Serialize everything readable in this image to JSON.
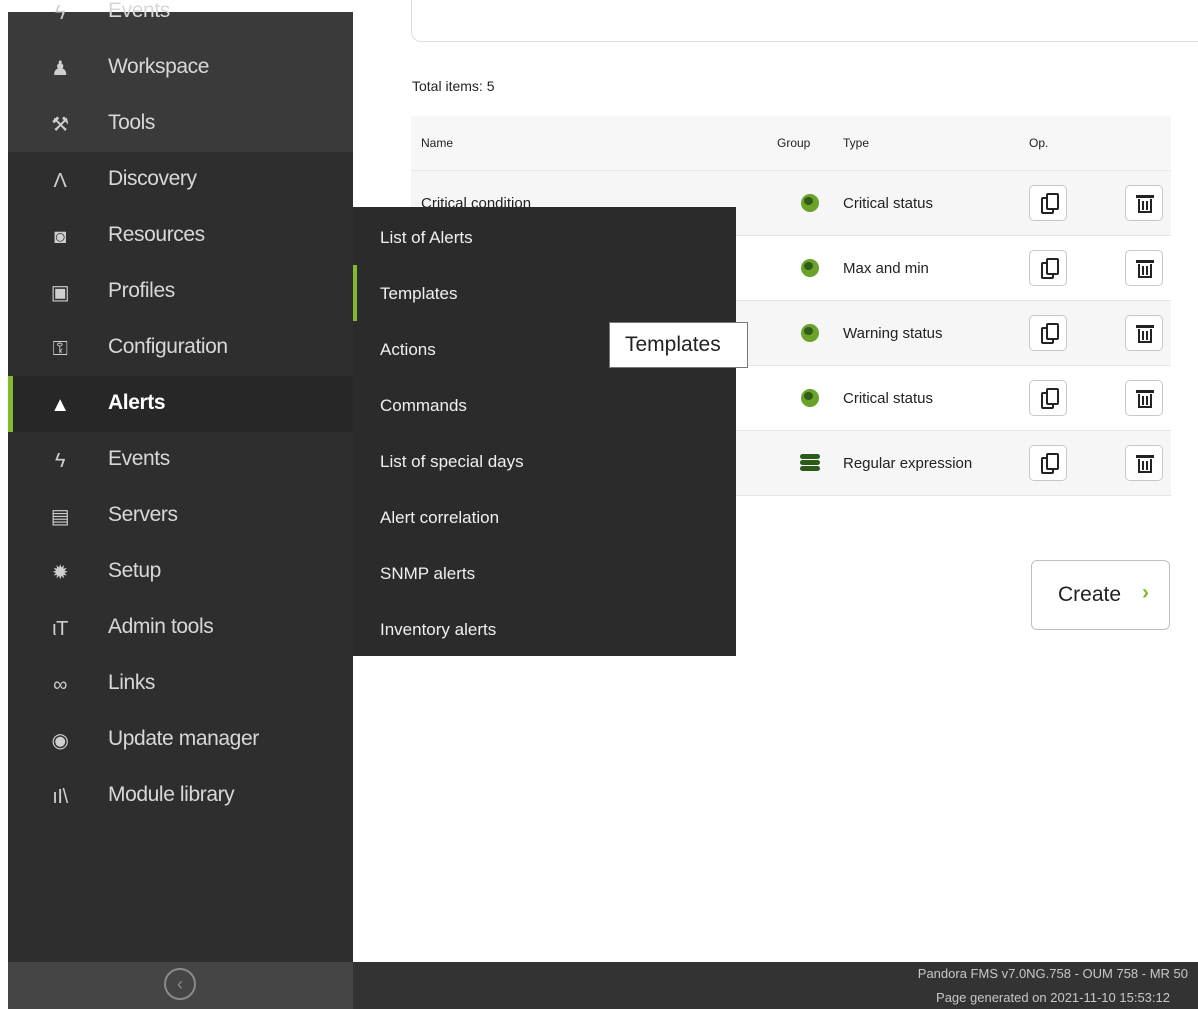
{
  "sidebar": {
    "items": [
      {
        "label": "Events",
        "icon": "lightning-icon",
        "glyph": "ϟ"
      },
      {
        "label": "Workspace",
        "icon": "user-icon",
        "glyph": "♟"
      },
      {
        "label": "Tools",
        "icon": "tools-icon",
        "glyph": "⚒"
      },
      {
        "label": "Discovery",
        "icon": "discovery-icon",
        "glyph": "Λ"
      },
      {
        "label": "Resources",
        "icon": "resources-icon",
        "glyph": "◙"
      },
      {
        "label": "Profiles",
        "icon": "profiles-icon",
        "glyph": "▣"
      },
      {
        "label": "Configuration",
        "icon": "wrench-icon",
        "glyph": "⚿"
      },
      {
        "label": "Alerts",
        "icon": "bell-icon",
        "glyph": "▲"
      },
      {
        "label": "Events",
        "icon": "events-icon",
        "glyph": "ϟ"
      },
      {
        "label": "Servers",
        "icon": "server-icon",
        "glyph": "▤"
      },
      {
        "label": "Setup",
        "icon": "gear-icon",
        "glyph": "✹"
      },
      {
        "label": "Admin tools",
        "icon": "admin-tools-icon",
        "glyph": "ιT"
      },
      {
        "label": "Links",
        "icon": "link-icon",
        "glyph": "∞"
      },
      {
        "label": "Update manager",
        "icon": "update-icon",
        "glyph": "◉"
      },
      {
        "label": "Module library",
        "icon": "library-icon",
        "glyph": "ıI\\"
      }
    ],
    "active_index": 7,
    "collapse_glyph": "‹"
  },
  "main": {
    "total_items": "Total items: 5",
    "table": {
      "headers": [
        "Name",
        "Group",
        "Type",
        "Op."
      ],
      "rows": [
        {
          "name": "Critical condition",
          "group_icon": "globe-icon",
          "type": "Critical status"
        },
        {
          "name": "",
          "group_icon": "globe-icon",
          "type": "Max and min"
        },
        {
          "name": "",
          "group_icon": "globe-icon",
          "type": "Warning status"
        },
        {
          "name": "",
          "group_icon": "globe-icon",
          "type": "Critical status"
        },
        {
          "name": "",
          "group_icon": "database-icon",
          "type": "Regular expression"
        }
      ]
    },
    "create_label": "Create",
    "create_chevron": "›"
  },
  "submenu": {
    "items": [
      "List of Alerts",
      "Templates",
      "Actions",
      "Commands",
      "List of special days",
      "Alert correlation",
      "SNMP alerts",
      "Inventory alerts"
    ],
    "active_index": 1
  },
  "tooltip": "Templates",
  "footer": {
    "version": "Pandora FMS v7.0NG.758 - OUM 758 - MR 50",
    "generated": "Page generated on 2021-11-10 15:53:12"
  },
  "colors": {
    "accent": "#82b92e",
    "sidebar_bg": "#2e2e2e",
    "submenu_bg": "#2b2b2b"
  }
}
